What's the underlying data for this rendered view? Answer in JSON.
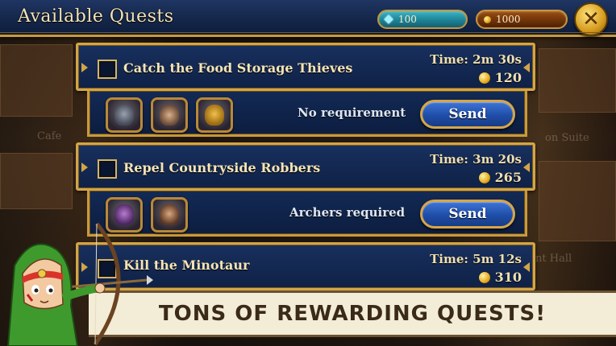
{
  "window": {
    "title": "Available Quests"
  },
  "currencies": {
    "gems": "100",
    "gold": "1000"
  },
  "close_icon": "close-icon",
  "background_labels": [
    "Cafe",
    "on Suite",
    "nt Hall"
  ],
  "quests": [
    {
      "name": "Catch the Food Storage Thieves",
      "time": "Time: 2m 30s",
      "reward": "120",
      "requirement": "No requirement",
      "send_label": "Send",
      "heroes": [
        "knight-portrait",
        "rogue-portrait",
        "spartan-helmet-portrait"
      ]
    },
    {
      "name": "Repel Countryside Robbers",
      "time": "Time: 3m 20s",
      "reward": "265",
      "requirement": "Archers required",
      "send_label": "Send",
      "heroes": [
        "mage-portrait",
        "archer-portrait"
      ]
    },
    {
      "name": "Kill the Minotaur",
      "time": "Time: 5m 12s",
      "reward": "310"
    }
  ],
  "banner": {
    "text": "TONS OF REWARDING QUESTS!"
  },
  "colors": {
    "panel_blue": "#132a55",
    "gold_border": "#d3a547",
    "button_blue": "#2a5fc0",
    "gem_cyan": "#2a9fb2",
    "gold_pill": "#6e3208"
  }
}
